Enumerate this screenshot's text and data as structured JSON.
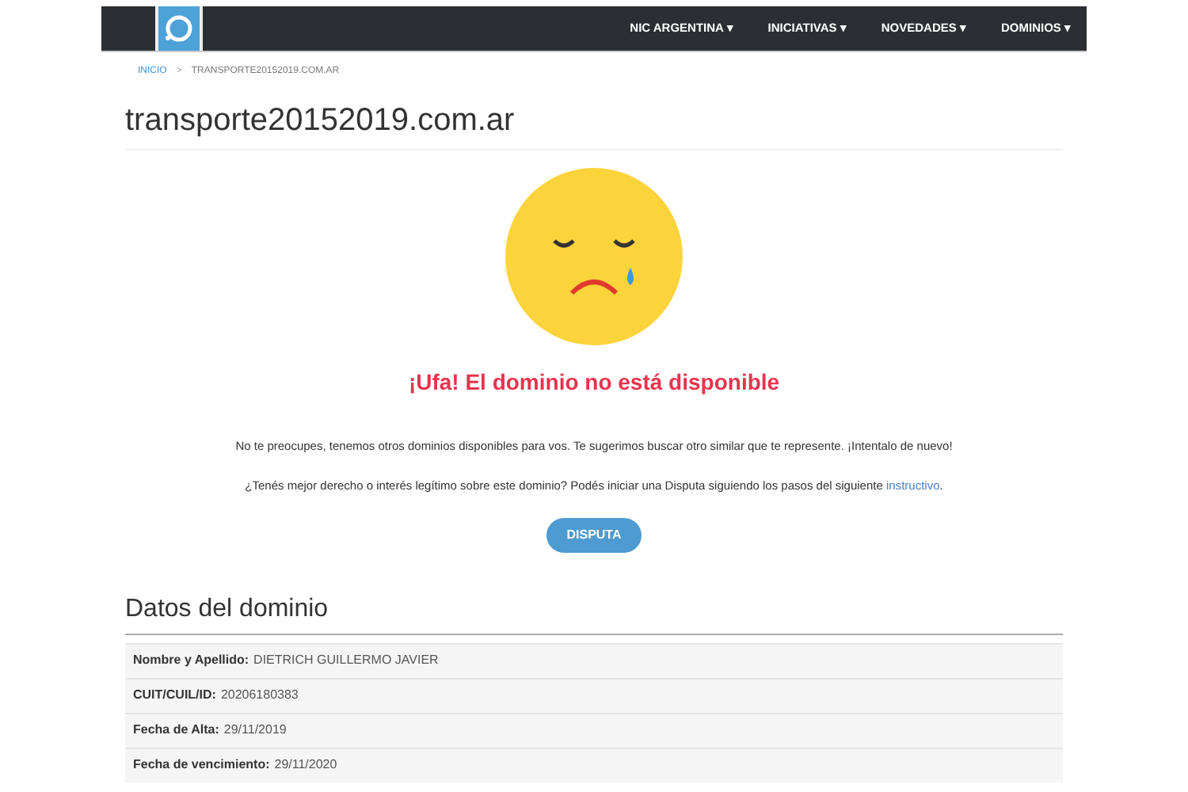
{
  "navbar": {
    "menu": [
      {
        "label": "NIC ARGENTINA",
        "caret": "▾"
      },
      {
        "label": "INICIATIVAS",
        "caret": "▾"
      },
      {
        "label": "NOVEDADES",
        "caret": "▾"
      },
      {
        "label": "DOMINIOS",
        "caret": "▾"
      }
    ]
  },
  "breadcrumb": [
    {
      "label": "INICIO",
      "link": true
    },
    {
      "label": "TRANSPORTE20152019.COM.AR",
      "link": false
    }
  ],
  "breadcrumb_separator": ">",
  "title": "transporte20152019.com.ar",
  "status": {
    "heading": "¡Ufa! El dominio no está disponible",
    "message": "No te preocupes, tenemos otros dominios disponibles para vos. Te sugerimos buscar otro similar que te represente. ¡Intentalo de nuevo!",
    "dispute_text": "¿Tenés mejor derecho o interés legítimo sobre este dominio? Podés iniciar una Disputa siguiendo los pasos del siguiente",
    "dispute_link": "instructivo",
    "dispute_end": ".",
    "button": "DISPUTA"
  },
  "details": {
    "heading": "Datos del dominio",
    "rows": [
      {
        "label": "Nombre y Apellido:",
        "value": "DIETRICH GUILLERMO JAVIER"
      },
      {
        "label": "CUIT/CUIL/ID:",
        "value": "20206180383"
      },
      {
        "label": "Fecha de Alta:",
        "value": "29/11/2019"
      },
      {
        "label": "Fecha de vencimiento:",
        "value": "29/11/2020"
      }
    ]
  }
}
